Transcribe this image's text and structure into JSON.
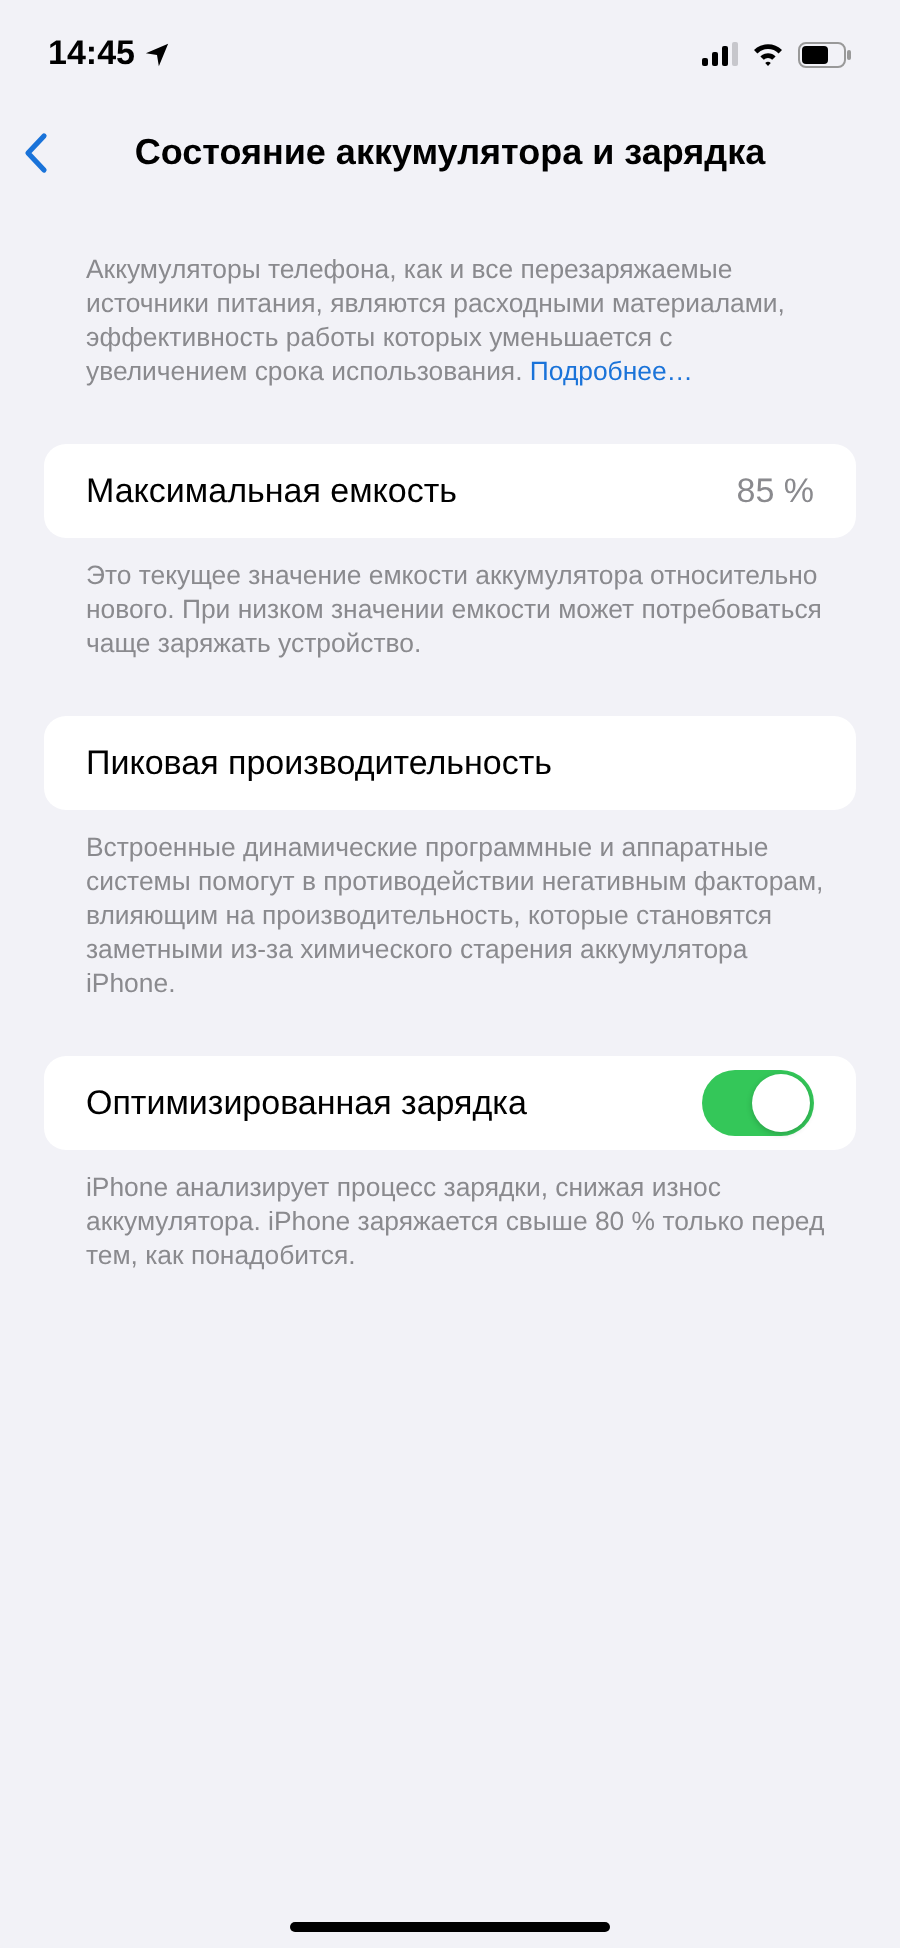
{
  "status_bar": {
    "time": "14:45"
  },
  "nav": {
    "title": "Состояние аккумулятора и зарядка"
  },
  "intro": {
    "text": "Аккумуляторы телефона, как и все перезаряжаемые источники питания, являются расходными материалами, эффективность работы которых уменьшается с увеличением срока использования.",
    "link": "Подробнее…"
  },
  "sections": [
    {
      "kind": "value",
      "label": "Максимальная емкость",
      "value": "85 %",
      "footer": "Это текущее значение емкости аккумулятора относительно нового. При низком значении емкости может потребоваться чаще заряжать устройство."
    },
    {
      "kind": "plain",
      "label": "Пиковая производительность",
      "footer": "Встроенные динамические программные и аппаратные системы помогут в противодействии негативным факторам, влияющим на производительность, которые становятся заметными из-за химического старения аккумулятора iPhone."
    },
    {
      "kind": "toggle",
      "label": "Оптимизированная зарядка",
      "on": true,
      "footer": "iPhone анализирует процесс зарядки, снижая износ аккумулятора. iPhone заряжается свыше 80 % только перед тем, как понадобится."
    }
  ]
}
